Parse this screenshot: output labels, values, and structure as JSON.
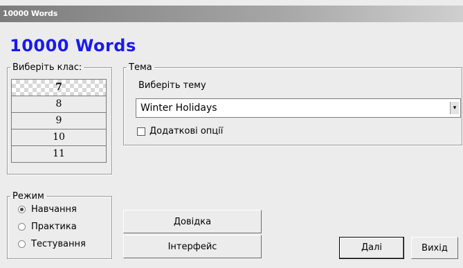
{
  "window": {
    "title": "10000 Words"
  },
  "app": {
    "heading": "10000 Words"
  },
  "class_select": {
    "legend": "Виберіть клас:",
    "items": [
      "7",
      "8",
      "9",
      "10",
      "11"
    ],
    "selected": "7"
  },
  "topic": {
    "legend": "Тема",
    "label": "Виберіть тему",
    "selected_value": "Winter Holidays",
    "extra_options_label": "Додаткові опції",
    "extra_options_checked": false
  },
  "mode": {
    "legend": "Режим",
    "options": [
      "Навчання",
      "Практика",
      "Тестування"
    ],
    "selected": "Навчання"
  },
  "buttons": {
    "help": "Довідка",
    "interface": "Інтерфейс",
    "next": "Далі",
    "exit": "Вихід"
  },
  "colors": {
    "heading": "#1a1aee",
    "titlebar_start": "#7c7c7c",
    "titlebar_end": "#cfcfcf"
  },
  "icons": {
    "dropdown": "chevron-down-icon"
  }
}
